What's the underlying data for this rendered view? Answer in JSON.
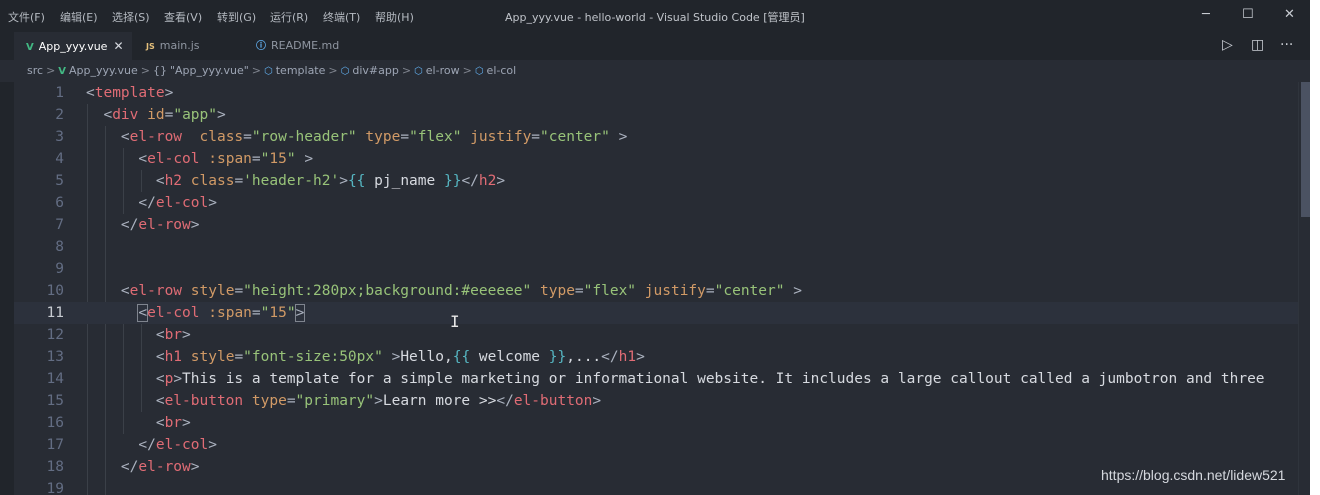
{
  "menu": [
    "文件(F)",
    "编辑(E)",
    "选择(S)",
    "查看(V)",
    "转到(G)",
    "运行(R)",
    "终端(T)",
    "帮助(H)"
  ],
  "window_title": "App_yyy.vue - hello-world - Visual Studio Code [管理员]",
  "window_controls": {
    "minimize": "─",
    "maximize": "☐",
    "close": "✕"
  },
  "tabs": [
    {
      "label": "App_yyy.vue",
      "icon": "V",
      "icon_name": "vue-file-icon",
      "active": true,
      "close": "✕"
    },
    {
      "label": "main.js",
      "icon": "JS",
      "icon_name": "js-file-icon",
      "active": false
    },
    {
      "label": "README.md",
      "icon": "ⓘ",
      "icon_name": "info-file-icon",
      "active": false
    }
  ],
  "tab_actions": {
    "run": "▷",
    "split": "◫",
    "more": "···"
  },
  "breadcrumb": {
    "items": [
      "src",
      "App_yyy.vue",
      "\"App_yyy.vue\"",
      "template",
      "div#app",
      "el-row",
      "el-col"
    ],
    "braces": "{}",
    "separator": ">"
  },
  "editor": {
    "line_numbers": [
      "1",
      "2",
      "3",
      "4",
      "5",
      "6",
      "7",
      "8",
      "9",
      "10",
      "11",
      "12",
      "13",
      "14",
      "15",
      "16",
      "17",
      "18",
      "19"
    ],
    "current_line": 11
  },
  "watermark": "https://blog.csdn.net/lidew521",
  "colors": {
    "background": "#282c34",
    "tag": "#e06c75",
    "attribute": "#d19a66",
    "string": "#98c379",
    "interpolation": "#56b6c2"
  }
}
